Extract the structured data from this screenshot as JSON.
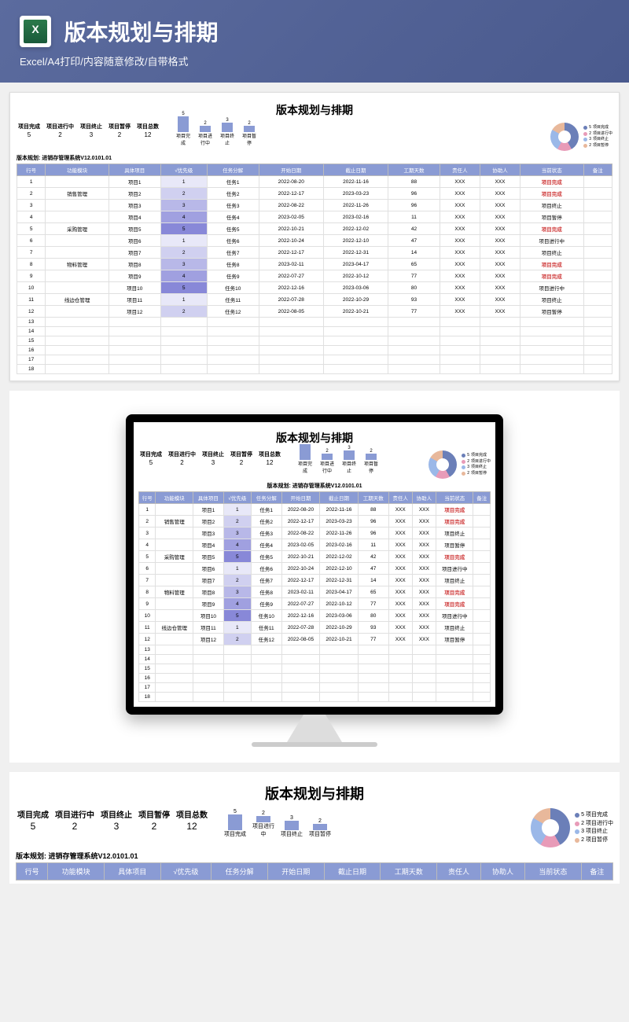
{
  "hero": {
    "title": "版本规划与排期",
    "sub": "Excel/A4打印/内容随意修改/自带格式"
  },
  "sheet": {
    "title": "版本规划与排期",
    "version_label": "版本规划:",
    "version": "进销存管理系统V12.0101.01",
    "stats": [
      {
        "l": "项目完成",
        "v": "5"
      },
      {
        "l": "项目进行中",
        "v": "2"
      },
      {
        "l": "项目终止",
        "v": "3"
      },
      {
        "l": "项目暂停",
        "v": "2"
      },
      {
        "l": "项目总数",
        "v": "12"
      }
    ],
    "bars": [
      {
        "l": "项目完成",
        "v": 5,
        "h": 20
      },
      {
        "l": "项目进行中",
        "v": 2,
        "h": 8
      },
      {
        "l": "项目终止",
        "v": 3,
        "h": 12
      },
      {
        "l": "项目暂停",
        "v": 2,
        "h": 8
      }
    ],
    "legend": [
      {
        "c": "#6B7FB8",
        "l": "项目完成",
        "v": "5"
      },
      {
        "c": "#E89BB8",
        "l": "项目进行中",
        "v": "2"
      },
      {
        "c": "#9BB8E8",
        "l": "项目终止",
        "v": "3"
      },
      {
        "c": "#E8B89B",
        "l": "项目暂停",
        "v": "2"
      }
    ],
    "headers": [
      "行号",
      "功能模块",
      "具体项目",
      "√优先级",
      "任务分解",
      "开始日期",
      "截止日期",
      "工期天数",
      "责任人",
      "协助人",
      "当前状态",
      "备注"
    ],
    "rows": [
      {
        "n": "1",
        "m": "",
        "p": "项目1",
        "pr": "1",
        "t": "任务1",
        "s": "2022-08-20",
        "e": "2022-11-16",
        "d": "88",
        "r": "XXX",
        "a": "XXX",
        "st": "项目完成",
        "red": 1
      },
      {
        "n": "2",
        "m": "销售管理",
        "p": "项目2",
        "pr": "2",
        "t": "任务2",
        "s": "2022-12-17",
        "e": "2023-03-23",
        "d": "96",
        "r": "XXX",
        "a": "XXX",
        "st": "项目完成",
        "red": 1
      },
      {
        "n": "3",
        "m": "",
        "p": "项目3",
        "pr": "3",
        "t": "任务3",
        "s": "2022-08-22",
        "e": "2022-11-26",
        "d": "96",
        "r": "XXX",
        "a": "XXX",
        "st": "项目终止"
      },
      {
        "n": "4",
        "m": "",
        "p": "项目4",
        "pr": "4",
        "t": "任务4",
        "s": "2023-02-05",
        "e": "2023-02-16",
        "d": "11",
        "r": "XXX",
        "a": "XXX",
        "st": "项目暂停"
      },
      {
        "n": "5",
        "m": "采购管理",
        "p": "项目5",
        "pr": "5",
        "t": "任务5",
        "s": "2022-10-21",
        "e": "2022-12-02",
        "d": "42",
        "r": "XXX",
        "a": "XXX",
        "st": "项目完成",
        "red": 1
      },
      {
        "n": "6",
        "m": "",
        "p": "项目6",
        "pr": "1",
        "t": "任务6",
        "s": "2022-10-24",
        "e": "2022-12-10",
        "d": "47",
        "r": "XXX",
        "a": "XXX",
        "st": "项目进行中"
      },
      {
        "n": "7",
        "m": "",
        "p": "项目7",
        "pr": "2",
        "t": "任务7",
        "s": "2022-12-17",
        "e": "2022-12-31",
        "d": "14",
        "r": "XXX",
        "a": "XXX",
        "st": "项目终止"
      },
      {
        "n": "8",
        "m": "物料管理",
        "p": "项目8",
        "pr": "3",
        "t": "任务8",
        "s": "2023-02-11",
        "e": "2023-04-17",
        "d": "65",
        "r": "XXX",
        "a": "XXX",
        "st": "项目完成",
        "red": 1
      },
      {
        "n": "9",
        "m": "",
        "p": "项目9",
        "pr": "4",
        "t": "任务9",
        "s": "2022-07-27",
        "e": "2022-10-12",
        "d": "77",
        "r": "XXX",
        "a": "XXX",
        "st": "项目完成",
        "red": 1
      },
      {
        "n": "10",
        "m": "",
        "p": "项目10",
        "pr": "5",
        "t": "任务10",
        "s": "2022-12-16",
        "e": "2023-03-06",
        "d": "80",
        "r": "XXX",
        "a": "XXX",
        "st": "项目进行中"
      },
      {
        "n": "11",
        "m": "线边仓管理",
        "p": "项目11",
        "pr": "1",
        "t": "任务11",
        "s": "2022-07-28",
        "e": "2022-10-29",
        "d": "93",
        "r": "XXX",
        "a": "XXX",
        "st": "项目终止"
      },
      {
        "n": "12",
        "m": "",
        "p": "项目12",
        "pr": "2",
        "t": "任务12",
        "s": "2022-08-05",
        "e": "2022-10-21",
        "d": "77",
        "r": "XXX",
        "a": "XXX",
        "st": "项目暂停"
      }
    ],
    "empty_rows": [
      "13",
      "14",
      "15",
      "16",
      "17",
      "18"
    ]
  },
  "chart_data": {
    "type": "bar",
    "title": "版本规划与排期",
    "categories": [
      "项目完成",
      "项目进行中",
      "项目终止",
      "项目暂停"
    ],
    "values": [
      5,
      2,
      3,
      2
    ],
    "xlabel": "",
    "ylabel": "",
    "ylim": [
      0,
      6
    ],
    "donut": {
      "type": "pie",
      "series": [
        {
          "name": "项目完成",
          "value": 5
        },
        {
          "name": "项目进行中",
          "value": 2
        },
        {
          "name": "项目终止",
          "value": 3
        },
        {
          "name": "项目暂停",
          "value": 2
        }
      ]
    }
  }
}
